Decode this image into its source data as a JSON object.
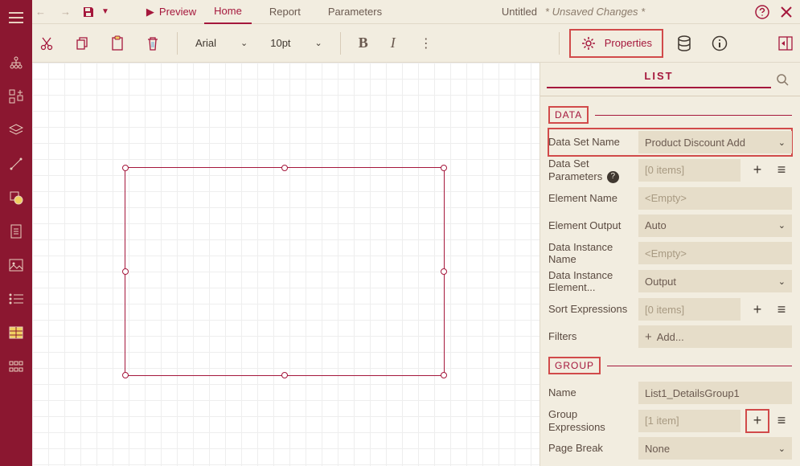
{
  "titlebar": {
    "preview_label": "Preview",
    "tabs": {
      "home": "Home",
      "report": "Report",
      "parameters": "Parameters"
    },
    "doc_title": "Untitled",
    "unsaved": "* Unsaved Changes *"
  },
  "toolbar": {
    "font": "Arial",
    "size": "10pt",
    "properties_label": "Properties"
  },
  "panel": {
    "tab_label": "LIST",
    "sections": {
      "data": {
        "title": "DATA",
        "data_set_name": {
          "label": "Data Set Name",
          "value": "Product Discount Add"
        },
        "data_set_parameters": {
          "label": "Data Set Parameters",
          "value": "[0 items]"
        },
        "element_name": {
          "label": "Element Name",
          "value": "<Empty>"
        },
        "element_output": {
          "label": "Element Output",
          "value": "Auto"
        },
        "data_instance_name": {
          "label": "Data Instance Name",
          "value": "<Empty>"
        },
        "data_instance_element": {
          "label": "Data Instance Element...",
          "value": "Output"
        },
        "sort_expressions": {
          "label": "Sort Expressions",
          "value": "[0 items]"
        },
        "filters": {
          "label": "Filters",
          "value": "Add..."
        }
      },
      "group": {
        "title": "GROUP",
        "name": {
          "label": "Name",
          "value": "List1_DetailsGroup1"
        },
        "group_expressions": {
          "label": "Group Expressions",
          "value": "[1 item]"
        },
        "page_break": {
          "label": "Page Break",
          "value": "None"
        }
      }
    }
  }
}
